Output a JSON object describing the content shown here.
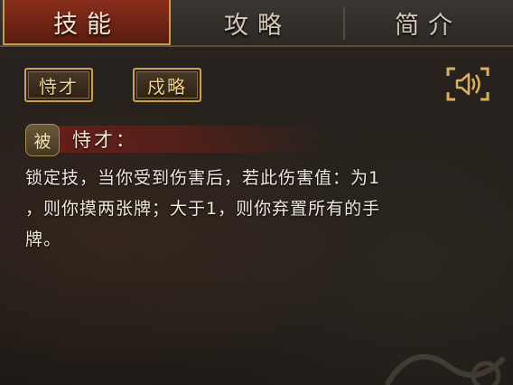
{
  "tabs": [
    {
      "label": "技能",
      "active": true
    },
    {
      "label": "攻略",
      "active": false
    },
    {
      "label": "简介",
      "active": false
    }
  ],
  "subtabs": [
    {
      "label": "恃才",
      "active": true
    },
    {
      "label": "戍略",
      "active": false
    }
  ],
  "skill": {
    "type_badge": "被",
    "name": "恃才：",
    "description": "锁定技，当你受到伤害后，若此伤害值：为1\n，则你摸两张牌；大于1，则你弃置所有的手\n牌。"
  },
  "icons": {
    "sound": "speaker-icon"
  },
  "colors": {
    "active_tab": "#7a2816",
    "gold_border": "#caa24a",
    "text": "#efe7da"
  }
}
